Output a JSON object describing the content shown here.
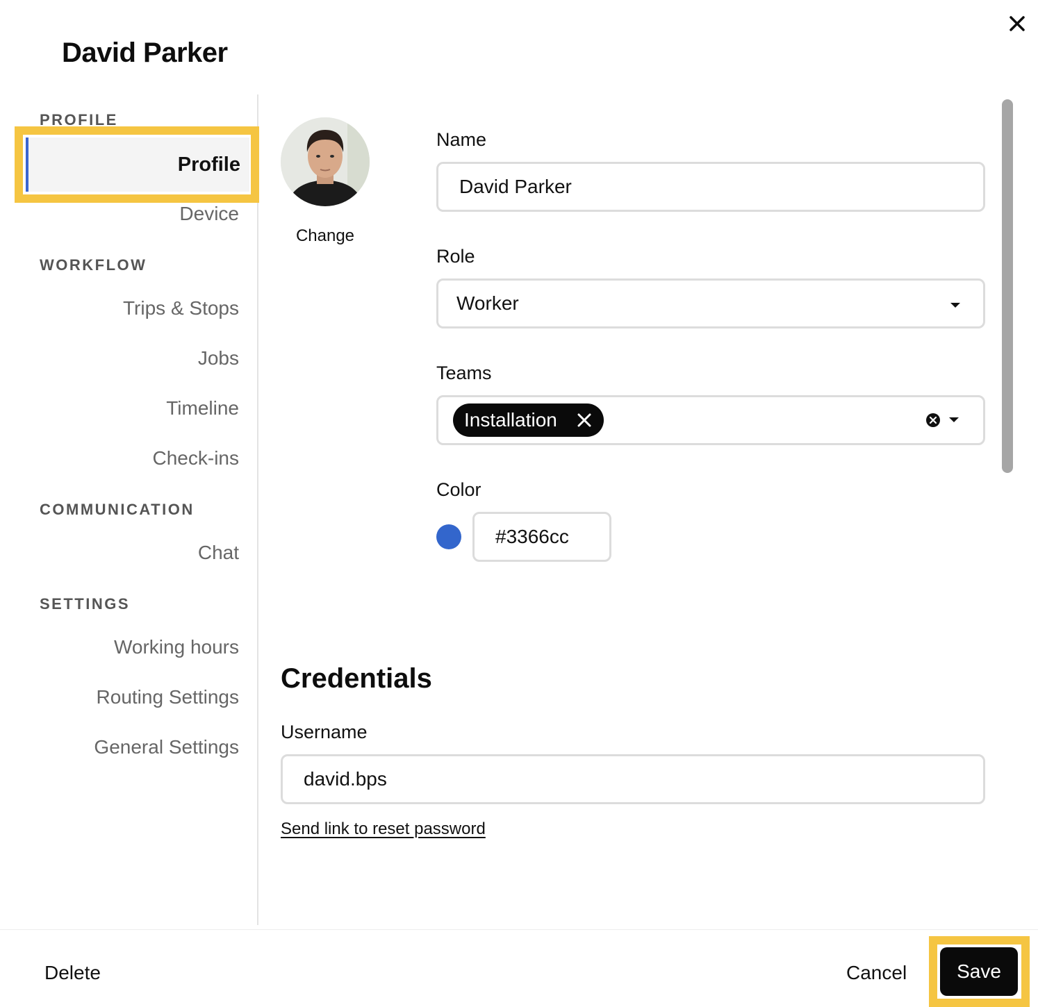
{
  "dialog": {
    "title": "David Parker"
  },
  "sidebar": {
    "sections": [
      {
        "label": "PROFILE",
        "items": [
          "Profile",
          "Device"
        ]
      },
      {
        "label": "WORKFLOW",
        "items": [
          "Trips & Stops",
          "Jobs",
          "Timeline",
          "Check-ins"
        ]
      },
      {
        "label": "COMMUNICATION",
        "items": [
          "Chat"
        ]
      },
      {
        "label": "SETTINGS",
        "items": [
          "Working hours",
          "Routing Settings",
          "General Settings"
        ]
      }
    ],
    "active_item": "Profile"
  },
  "avatar": {
    "change_label": "Change"
  },
  "form": {
    "name": {
      "label": "Name",
      "value": "David Parker"
    },
    "role": {
      "label": "Role",
      "value": "Worker"
    },
    "teams": {
      "label": "Teams",
      "chips": [
        "Installation"
      ]
    },
    "color": {
      "label": "Color",
      "value": "#3366cc",
      "swatch": "#3366cc"
    }
  },
  "credentials": {
    "title": "Credentials",
    "username": {
      "label": "Username",
      "value": "david.bps"
    },
    "reset_link": "Send link to reset password"
  },
  "footer": {
    "delete": "Delete",
    "cancel": "Cancel",
    "save": "Save"
  },
  "colors": {
    "accent": "#3b66d0",
    "highlight": "#f5c542",
    "primary_button": "#0a0a0a"
  }
}
